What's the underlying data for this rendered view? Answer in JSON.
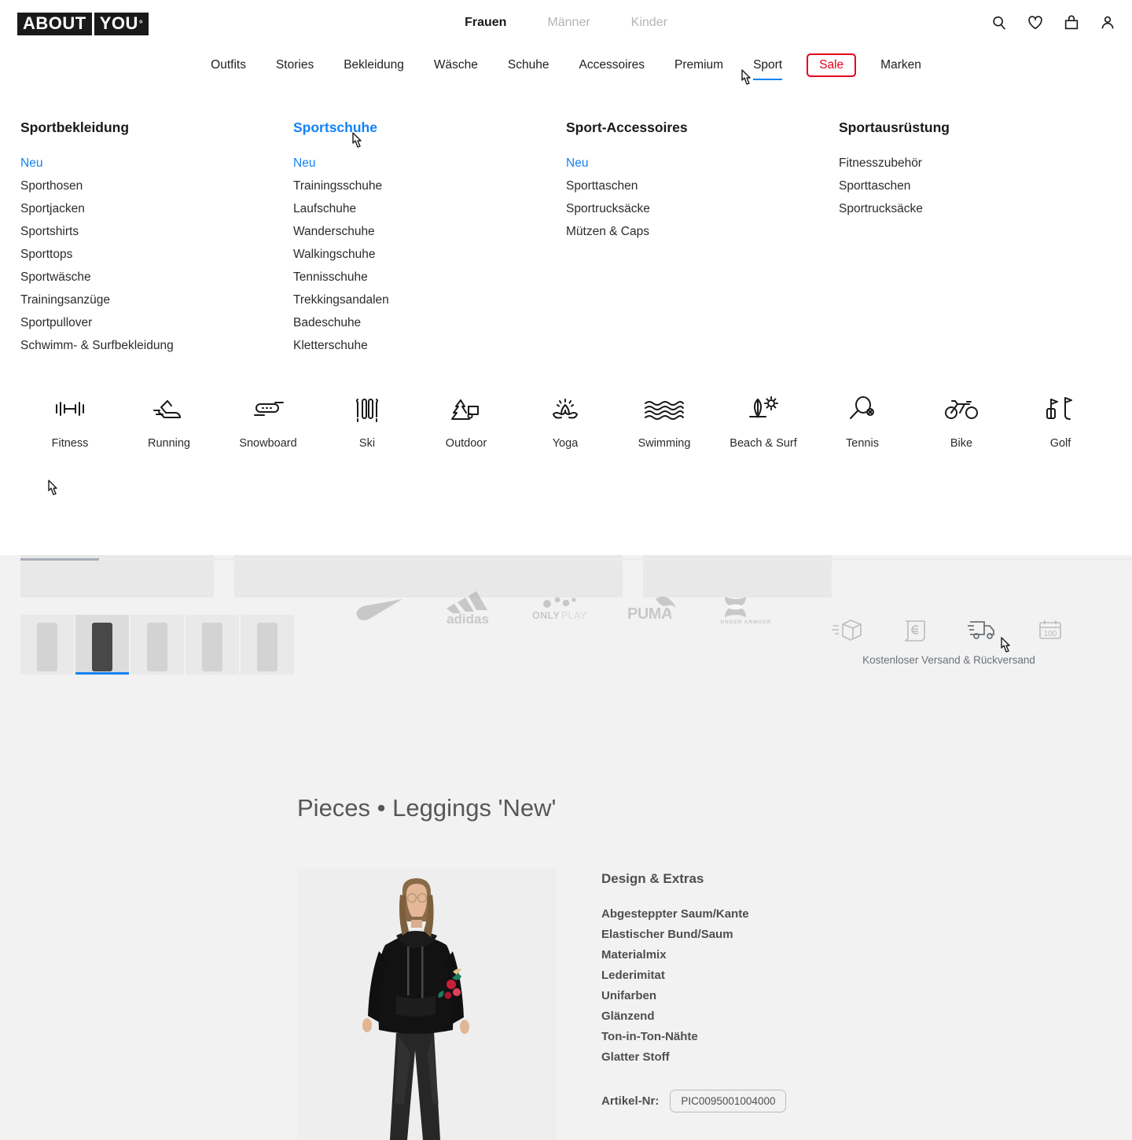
{
  "brand": {
    "logo_part1": "ABOUT",
    "logo_part2": "YOU",
    "logo_degree": "°"
  },
  "header": {
    "gender_nav": [
      {
        "label": "Frauen",
        "active": true
      },
      {
        "label": "Männer",
        "active": false
      },
      {
        "label": "Kinder",
        "active": false
      }
    ],
    "icons": [
      {
        "name": "search-icon",
        "label": "Suche"
      },
      {
        "name": "heart-icon",
        "label": "Wunschliste"
      },
      {
        "name": "bag-icon",
        "label": "Warenkorb"
      },
      {
        "name": "user-icon",
        "label": "Konto"
      }
    ],
    "main_nav": [
      {
        "label": "Outfits",
        "active": false
      },
      {
        "label": "Stories",
        "active": false
      },
      {
        "label": "Bekleidung",
        "active": false
      },
      {
        "label": "Wäsche",
        "active": false
      },
      {
        "label": "Schuhe",
        "active": false
      },
      {
        "label": "Accessoires",
        "active": false
      },
      {
        "label": "Premium",
        "active": false
      },
      {
        "label": "Sport",
        "active": true
      },
      {
        "label": "Marken",
        "active": false
      }
    ],
    "sale_label": "Sale",
    "accent_blue": "#1282f5",
    "sale_red": "#e2001a"
  },
  "mega_menu": {
    "columns": [
      {
        "title": "Sportbekleidung",
        "title_highlighted": false,
        "links": [
          {
            "label": "Neu",
            "highlighted": true
          },
          {
            "label": "Sporthosen",
            "highlighted": false
          },
          {
            "label": "Sportjacken",
            "highlighted": false
          },
          {
            "label": "Sportshirts",
            "highlighted": false
          },
          {
            "label": "Sporttops",
            "highlighted": false
          },
          {
            "label": "Sportwäsche",
            "highlighted": false
          },
          {
            "label": "Trainingsanzüge",
            "highlighted": false
          },
          {
            "label": "Sportpullover",
            "highlighted": false
          },
          {
            "label": "Schwimm- & Surfbekleidung",
            "highlighted": false
          }
        ]
      },
      {
        "title": "Sportschuhe",
        "title_highlighted": true,
        "links": [
          {
            "label": "Neu",
            "highlighted": true
          },
          {
            "label": "Trainingsschuhe",
            "highlighted": false
          },
          {
            "label": "Laufschuhe",
            "highlighted": false
          },
          {
            "label": "Wanderschuhe",
            "highlighted": false
          },
          {
            "label": "Walkingschuhe",
            "highlighted": false
          },
          {
            "label": "Tennisschuhe",
            "highlighted": false
          },
          {
            "label": "Trekkingsandalen",
            "highlighted": false
          },
          {
            "label": "Badeschuhe",
            "highlighted": false
          },
          {
            "label": "Kletterschuhe",
            "highlighted": false
          }
        ]
      },
      {
        "title": "Sport-Accessoires",
        "title_highlighted": false,
        "links": [
          {
            "label": "Neu",
            "highlighted": true
          },
          {
            "label": "Sporttaschen",
            "highlighted": false
          },
          {
            "label": "Sportrucksäcke",
            "highlighted": false
          },
          {
            "label": "Mützen & Caps",
            "highlighted": false
          }
        ]
      },
      {
        "title": "Sportausrüstung",
        "title_highlighted": false,
        "links": [
          {
            "label": "Fitnesszubehör",
            "highlighted": false
          },
          {
            "label": "Sporttaschen",
            "highlighted": false
          },
          {
            "label": "Sportrucksäcke",
            "highlighted": false
          }
        ]
      }
    ],
    "categories": [
      {
        "label": "Fitness",
        "icon": "dumbbell-icon"
      },
      {
        "label": "Running",
        "icon": "running-shoe-icon"
      },
      {
        "label": "Snowboard",
        "icon": "snowboard-icon"
      },
      {
        "label": "Ski",
        "icon": "ski-icon"
      },
      {
        "label": "Outdoor",
        "icon": "outdoor-tent-icon"
      },
      {
        "label": "Yoga",
        "icon": "lotus-icon"
      },
      {
        "label": "Swimming",
        "icon": "waves-icon"
      },
      {
        "label": "Beach & Surf",
        "icon": "surfboard-sun-icon"
      },
      {
        "label": "Tennis",
        "icon": "tennis-racket-icon"
      },
      {
        "label": "Bike",
        "icon": "bicycle-icon"
      },
      {
        "label": "Golf",
        "icon": "golf-icon"
      }
    ],
    "brands": [
      {
        "label": "Nike",
        "icon": "nike-swoosh-logo"
      },
      {
        "label": "adidas",
        "icon": "adidas-logo"
      },
      {
        "label": "ONLY PLAY",
        "icon": "onlyplay-logo"
      },
      {
        "label": "PUMA",
        "icon": "puma-logo"
      },
      {
        "label": "UNDER ARMOUR",
        "icon": "under-armour-logo"
      }
    ]
  },
  "services": {
    "items": [
      {
        "icon": "package-icon",
        "active": false
      },
      {
        "icon": "euro-receipt-icon",
        "active": false
      },
      {
        "icon": "delivery-truck-icon",
        "active": true
      },
      {
        "icon": "calendar-100-icon",
        "active": false
      }
    ],
    "label": "Kostenloser Versand & Rückversand",
    "calendar_number": "100"
  },
  "product": {
    "title": "Pieces • Leggings 'New'",
    "specs_title": "Design & Extras",
    "specs": [
      "Abgesteppter Saum/Kante",
      "Elastischer Bund/Saum",
      "Materialmix",
      "Lederimitat",
      "Unifarben",
      "Glänzend",
      "Ton-in-Ton-Nähte",
      "Glatter Stoff"
    ],
    "article_label": "Artikel-Nr:",
    "article_number": "PIC0095001004000",
    "thumbnails": [
      {
        "selected": false
      },
      {
        "selected": true
      },
      {
        "selected": false
      },
      {
        "selected": false
      },
      {
        "selected": false
      }
    ]
  }
}
